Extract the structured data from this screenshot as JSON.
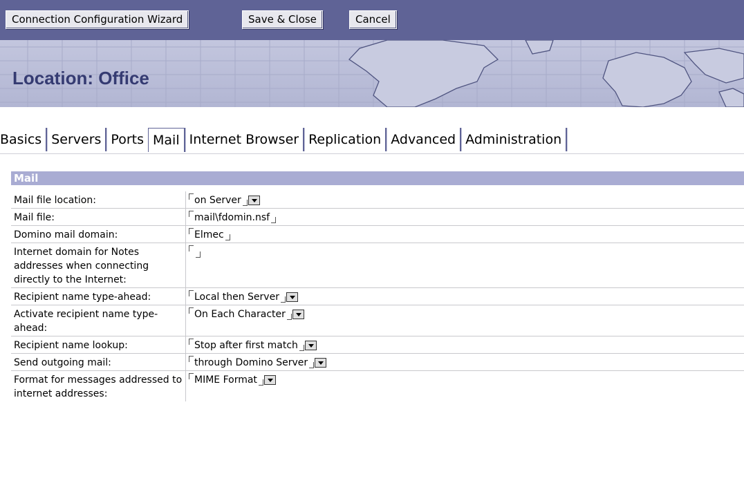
{
  "toolbar": {
    "buttons": [
      "Connection Configuration Wizard",
      "Save & Close",
      "Cancel"
    ]
  },
  "banner": {
    "title": "Location: Office"
  },
  "tabs": [
    "Basics",
    "Servers",
    "Ports",
    "Mail",
    "Internet Browser",
    "Replication",
    "Advanced",
    "Administration"
  ],
  "active_tab": "Mail",
  "section": {
    "title": "Mail"
  },
  "fields": [
    {
      "label": "Mail file location:",
      "value": "on Server",
      "dropdown": true
    },
    {
      "label": "Mail file:",
      "value": "mail\\fdomin.nsf",
      "dropdown": false
    },
    {
      "label": "Domino mail domain:",
      "value": "Elmec",
      "dropdown": false
    },
    {
      "label": "Internet domain for Notes addresses when connecting directly to the Internet:",
      "value": "",
      "dropdown": false
    },
    {
      "label": "Recipient name type-ahead:",
      "value": "Local then Server",
      "dropdown": true
    },
    {
      "label": "Activate recipient name type-ahead:",
      "value": "On Each Character",
      "dropdown": true
    },
    {
      "label": "Recipient name lookup:",
      "value": "Stop after first match",
      "dropdown": true
    },
    {
      "label": "Send outgoing mail:",
      "value": "through Domino Server",
      "dropdown": true
    },
    {
      "label": "Format for messages addressed to internet addresses:",
      "value": "MIME Format",
      "dropdown": true
    }
  ],
  "colors": {
    "toolbar": "#5f6396",
    "banner": "#b9bdd8",
    "banner_title": "#353b72",
    "section_header": "#a9acd3"
  }
}
